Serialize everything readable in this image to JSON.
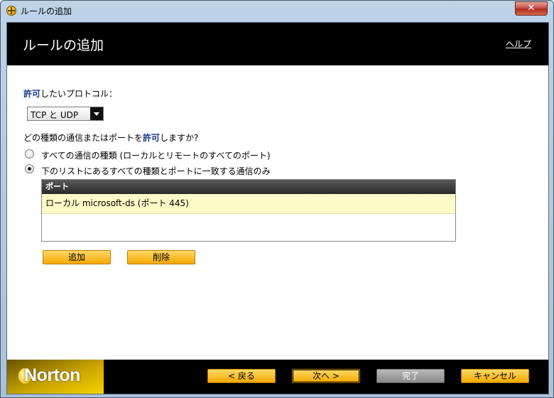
{
  "window": {
    "title": "ルールの追加",
    "close_label": "✕"
  },
  "header": {
    "title": "ルールの追加",
    "help_label": "ヘルプ"
  },
  "protocol": {
    "label_emph": "許可",
    "label_rest": "したいプロトコル：",
    "selected": "TCP と UDP"
  },
  "question": {
    "text_before": "どの種類の通信またはポートを",
    "text_emph": "許可",
    "text_after": "しますか?"
  },
  "radios": [
    {
      "label": "すべての通信の種類 (ローカルとリモートのすべてのポート)",
      "checked": false
    },
    {
      "label": "下のリストにあるすべての種類とポートに一致する通信のみ",
      "checked": true
    }
  ],
  "port_list": {
    "header": "ポート",
    "rows": [
      "ローカル microsoft-ds (ポート 445)"
    ]
  },
  "list_buttons": {
    "add": "追加",
    "delete": "削除"
  },
  "footer": {
    "logo": "Norton",
    "back": "< 戻る",
    "next": "次へ >",
    "finish": "完了",
    "cancel": "キャンセル"
  },
  "colors": {
    "accent_button": "#f5a800",
    "emphasis_text": "#1a3c8c",
    "list_row_highlight": "#fdfac8"
  }
}
